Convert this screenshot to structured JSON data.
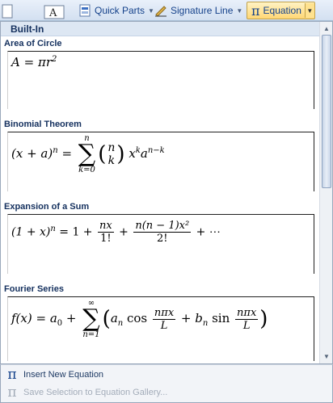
{
  "ribbon": {
    "quick_parts_label": "Quick Parts",
    "signature_line_label": "Signature Line",
    "equation_label": "Equation"
  },
  "gallery": {
    "category_label": "Built-In",
    "items": [
      {
        "title": "Area of Circle"
      },
      {
        "title": "Binomial Theorem"
      },
      {
        "title": "Expansion of a Sum"
      },
      {
        "title": "Fourier Series"
      }
    ]
  },
  "equations": {
    "area": {
      "A": "A",
      "eq": " = ",
      "pi": "π",
      "r": "r",
      "exp": "2"
    },
    "binomial": {
      "lhs": "(x + a)",
      "lhs_exp": "n",
      "eq": " = ",
      "sum_top": "n",
      "sum_bottom": "k=0",
      "binom_top": "n",
      "binom_bottom": "k",
      "x": "x",
      "x_exp": "k",
      "a": "a",
      "a_exp": "n−k"
    },
    "expansion": {
      "lhs": "(1 + x)",
      "lhs_exp": "n",
      "eq": " = 1 + ",
      "f1_num": "nx",
      "f1_den": "1!",
      "plus": " + ",
      "f2_num": "n(n − 1)x²",
      "f2_den": "2!",
      "tail": " + ⋯"
    },
    "fourier": {
      "lhs": "f(x) = a",
      "lhs_sub": "0",
      "plus": " + ",
      "sum_top": "∞",
      "sum_bottom": "n=1",
      "an": "a",
      "an_sub": "n",
      "cos": " cos ",
      "f1_num": "nπx",
      "f1_den": "L",
      "mid": " + ",
      "bn": "b",
      "bn_sub": "n",
      "sin": " sin ",
      "f2_num": "nπx",
      "f2_den": "L"
    }
  },
  "footer": {
    "insert_label": "Insert New Equation",
    "save_label": "Save Selection to Equation Gallery..."
  }
}
